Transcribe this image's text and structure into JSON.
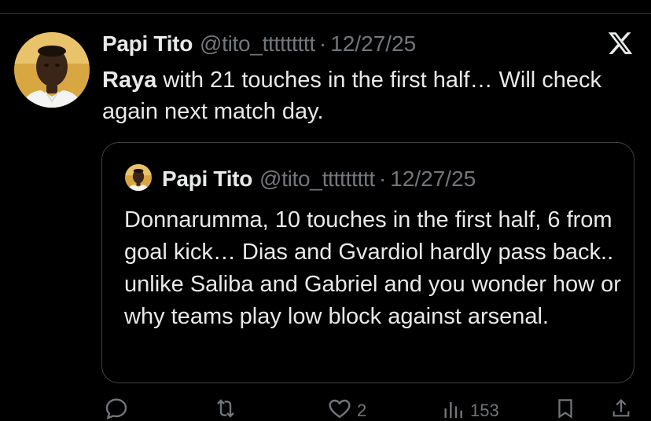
{
  "tweet": {
    "author_name": "Papi Tito",
    "handle": "@tito_ttttttttt",
    "separator": "·",
    "date": "12/27/25",
    "text_bold": "Raya",
    "text_rest": " with 21 touches in the first half… Will check again next match day."
  },
  "quoted_tweet": {
    "author_name": "Papi Tito",
    "handle": "@tito_ttttttttt",
    "separator": "·",
    "date": "12/27/25",
    "text": "Donnarumma, 10 touches in the first half, 6 from goal kick… Dias and Gvardiol hardly pass back.. unlike Saliba and Gabriel and you wonder how or why teams play low block against arsenal."
  },
  "actions": {
    "likes_count": "2",
    "views_count": "153"
  },
  "icons": {
    "brand": "x-logo-icon",
    "reply": "reply-icon",
    "repost": "repost-icon",
    "like": "heart-icon",
    "views": "views-icon",
    "bookmark": "bookmark-icon",
    "share": "share-icon"
  },
  "colors": {
    "background": "#000000",
    "text": "#e7e9ea",
    "secondary_text": "#71767b",
    "border": "#3e4144"
  }
}
